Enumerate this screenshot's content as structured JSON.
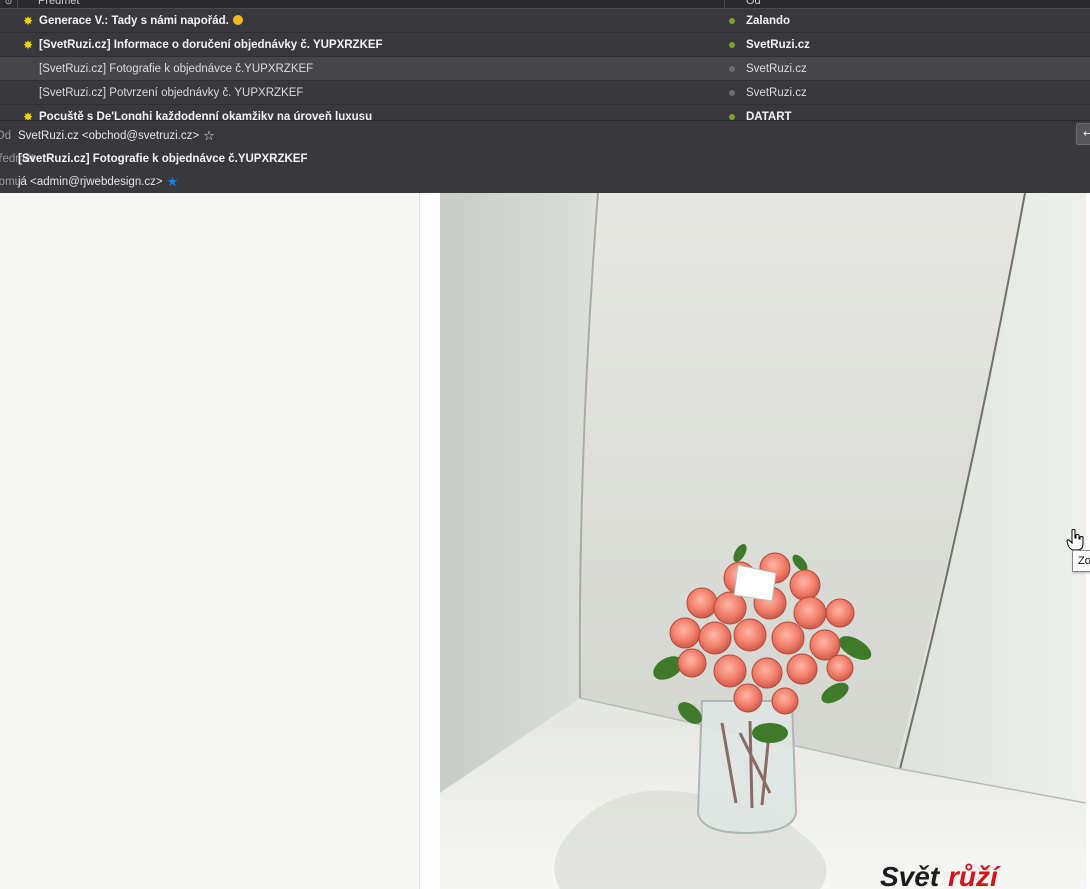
{
  "message_list": {
    "columns": {
      "thread_icon": "thread-icon",
      "subject": "Předmět",
      "from": "Od"
    },
    "rows": [
      {
        "subject": "Generace V.: Tady s námi napořád.",
        "from": "Zalando",
        "starred": true,
        "unread": true,
        "emoji": "face-emoji"
      },
      {
        "subject": "[SvetRuzi.cz] Informace o doručení objednávky č. YUPXRZKEF",
        "from": "SvetRuzi.cz",
        "starred": true,
        "unread": true
      },
      {
        "subject": "[SvetRuzi.cz] Fotografie k objednávce č.YUPXRZKEF",
        "from": "SvetRuzi.cz",
        "starred": false,
        "unread": false,
        "selected": true
      },
      {
        "subject": "[SvetRuzi.cz] Potvrzení objednávky č. YUPXRZKEF",
        "from": "SvetRuzi.cz",
        "starred": false,
        "unread": false
      },
      {
        "subject": "Pocuště s De'Longhi každodenní okamžiky na úroveň luxusu",
        "from": "DATART",
        "starred": true,
        "unread": true
      }
    ]
  },
  "message_header": {
    "from_label": "Od",
    "from_value": "SvetRuzi.cz <obchod@svetruzi.cz>",
    "subject_label": "Předmět",
    "subject_value": "[SvetRuzi.cz] Fotografie k objednávce č.YUPXRZKEF",
    "to_label": "Komu",
    "to_value": "já <admin@rjwebdesign.cz>",
    "reply_icon": "reply-arrow-icon"
  },
  "photo": {
    "logo_text_dark": "Svět",
    "logo_text_red": "růží",
    "colors": {
      "brand_red": "#d0161b",
      "rose": "#f27f6c",
      "leaf": "#3f7a2a"
    }
  },
  "tooltip": {
    "text": "Zo"
  },
  "colors": {
    "list_bg": "#38383d",
    "unread_dot": "#7ea52a",
    "star": "#f5d01a",
    "contact_star": "#0a84ff"
  }
}
